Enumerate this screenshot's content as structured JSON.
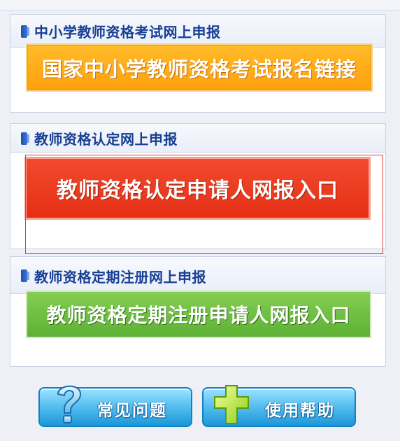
{
  "sections": [
    {
      "title": "中小学教师资格考试网上申报",
      "button_label": "国家中小学教师资格考试报名链接"
    },
    {
      "title": "教师资格认定网上申报",
      "button_label": "教师资格认定申请人网报入口"
    },
    {
      "title": "教师资格定期注册网上申报",
      "button_label": "教师资格定期注册申请人网报入口"
    }
  ],
  "bottom": {
    "faq_label": "常见问题",
    "help_label": "使用帮助"
  },
  "colors": {
    "orange": "#ffa00c",
    "red": "#e52f15",
    "green": "#5cb135",
    "blue": "#1c97d8",
    "title": "#173f94"
  }
}
